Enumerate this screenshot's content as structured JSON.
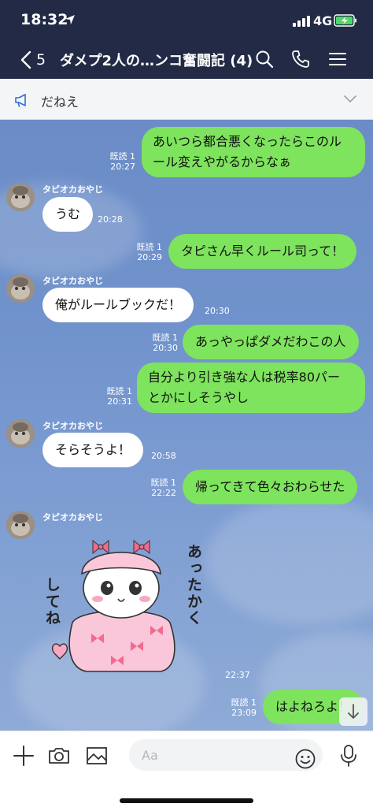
{
  "status": {
    "time": "18:32",
    "network": "4G"
  },
  "header": {
    "back_count": "5",
    "title": "ダメプ2人の…ンコ奮闘記 (4)"
  },
  "announcement": {
    "text": "だねえ"
  },
  "messages": [
    {
      "type": "out",
      "lines": [
        "あいつら都合悪くなったらこのル",
        "ール変えやがるからなぁ"
      ],
      "read": "既読 1",
      "time": "20:27"
    },
    {
      "type": "in",
      "sender": "タピオカおやじ",
      "text": "うむ",
      "time": "20:28"
    },
    {
      "type": "out",
      "lines": [
        "タピさん早くルール司って！"
      ],
      "read": "既読 1",
      "time": "20:29"
    },
    {
      "type": "in",
      "sender": "タピオカおやじ",
      "text": "俺がルールブックだ！",
      "time": "20:30"
    },
    {
      "type": "out",
      "lines": [
        "あっやっぱダメだわこの人"
      ],
      "read": "既読 1",
      "time": "20:30"
    },
    {
      "type": "out",
      "lines": [
        "自分より引き強な人は税率80パー",
        "とかにしそうやし"
      ],
      "read": "既読 1",
      "time": "20:31"
    },
    {
      "type": "in",
      "sender": "タピオカおやじ",
      "text": "そらそうよ！",
      "time": "20:58"
    },
    {
      "type": "out",
      "lines": [
        "帰ってきて色々おわらせた"
      ],
      "read": "既読 1",
      "time": "22:22"
    },
    {
      "type": "in-sticker",
      "sender": "タピオカおやじ",
      "sticker_text_1": "あったかく",
      "sticker_text_2": "してね",
      "time": "22:37"
    },
    {
      "type": "out",
      "lines": [
        "はよねろよ！"
      ],
      "read": "既読 1",
      "time": "23:09"
    }
  ],
  "input": {
    "placeholder": "Aa"
  },
  "icons": {
    "back": "chevron-left-icon",
    "search": "search-icon",
    "call": "phone-icon",
    "menu": "hamburger-menu-icon",
    "announce": "megaphone-icon",
    "expand": "chevron-down-icon",
    "plus": "plus-icon",
    "camera": "camera-icon",
    "image": "image-icon",
    "emoji": "emoji-icon",
    "mic": "microphone-icon",
    "scroll": "arrow-down-icon"
  },
  "colors": {
    "header_bg": "#222a45",
    "outgoing_bubble": "#7ee35d",
    "incoming_bubble": "#ffffff",
    "chat_bg": "#7193cc",
    "battery_fill": "#4cd964"
  }
}
